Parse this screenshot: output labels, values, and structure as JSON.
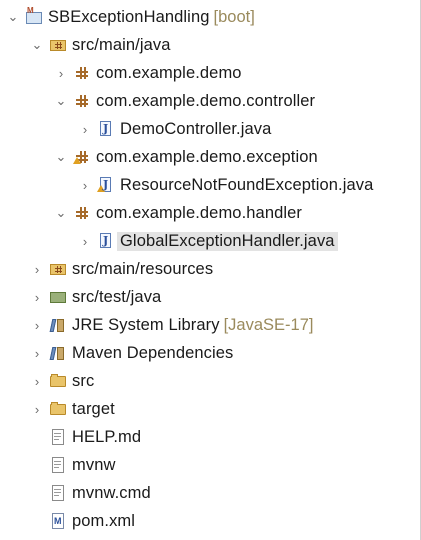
{
  "tree": {
    "rows": [
      {
        "label": "SBExceptionHandling",
        "decoration": "[boot]",
        "chevron": "⌄",
        "icon": "maven-project-icon"
      },
      {
        "label": "src/main/java",
        "chevron": "⌄",
        "icon": "source-folder-icon"
      },
      {
        "label": "com.example.demo",
        "chevron": "›",
        "icon": "package-icon"
      },
      {
        "label": "com.example.demo.controller",
        "chevron": "⌄",
        "icon": "package-icon"
      },
      {
        "label": "DemoController.java",
        "chevron": "›",
        "icon": "java-file-icon"
      },
      {
        "label": "com.example.demo.exception",
        "chevron": "⌄",
        "icon": "package-warning-icon"
      },
      {
        "label": "ResourceNotFoundException.java",
        "chevron": "›",
        "icon": "java-file-warning-icon"
      },
      {
        "label": "com.example.demo.handler",
        "chevron": "⌄",
        "icon": "package-icon"
      },
      {
        "label": "GlobalExceptionHandler.java",
        "chevron": "›",
        "icon": "java-file-icon",
        "selected": true
      },
      {
        "label": "src/main/resources",
        "chevron": "›",
        "icon": "source-folder-icon"
      },
      {
        "label": "src/test/java",
        "chevron": "›",
        "icon": "test-folder-icon"
      },
      {
        "label": "JRE System Library",
        "decoration": "[JavaSE-17]",
        "chevron": "›",
        "icon": "library-icon"
      },
      {
        "label": "Maven Dependencies",
        "chevron": "›",
        "icon": "library-icon"
      },
      {
        "label": "src",
        "chevron": "›",
        "icon": "folder-icon"
      },
      {
        "label": "target",
        "chevron": "›",
        "icon": "folder-icon"
      },
      {
        "label": "HELP.md",
        "chevron": "",
        "icon": "markdown-file-icon"
      },
      {
        "label": "mvnw",
        "chevron": "",
        "icon": "text-file-icon"
      },
      {
        "label": "mvnw.cmd",
        "chevron": "",
        "icon": "text-file-icon"
      },
      {
        "label": "pom.xml",
        "chevron": "",
        "icon": "maven-pom-icon"
      }
    ]
  }
}
